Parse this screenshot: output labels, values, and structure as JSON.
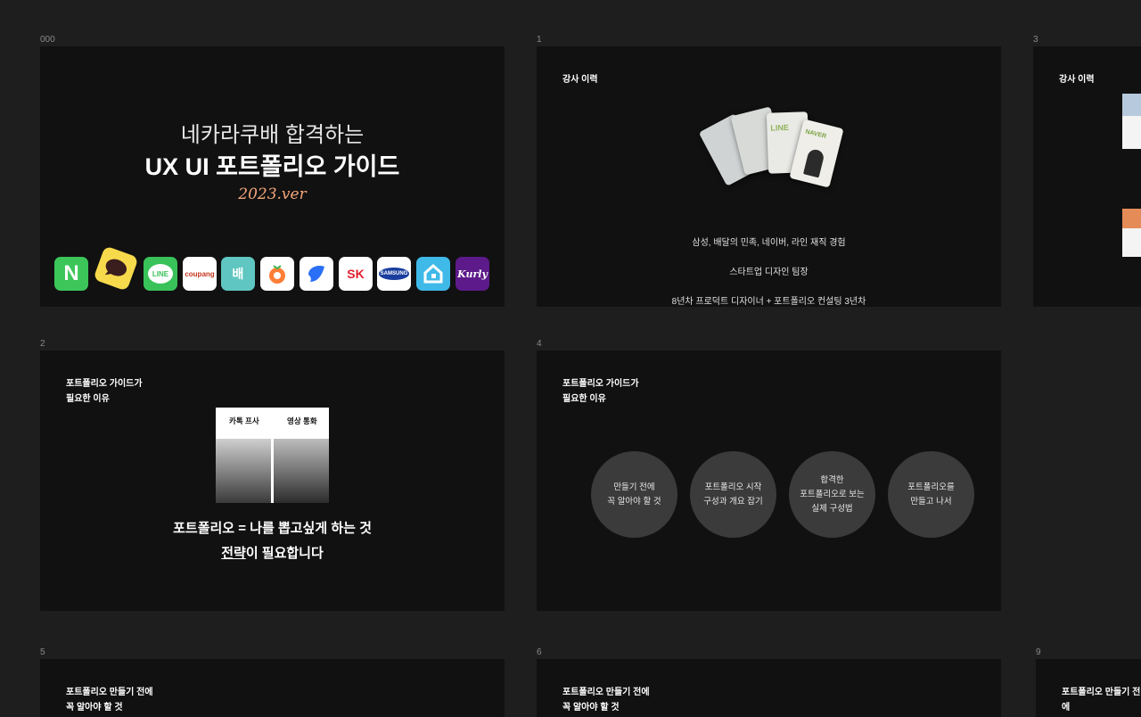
{
  "frames": [
    {
      "label": "000",
      "cover": {
        "line1": "네카라쿠배 합격하는",
        "line2": "UX UI 포트폴리오 가이드",
        "version": "2023.ver",
        "apps": [
          {
            "name": "naver",
            "text": "N",
            "bg": "#3cc65a",
            "fg": "#ffffff"
          },
          {
            "name": "kakaotalk",
            "text": "",
            "bg": "#f7d94c",
            "fg": "#3a1d1d"
          },
          {
            "name": "line",
            "text": "LINE",
            "bg": "#39c25a",
            "fg": "#ffffff"
          },
          {
            "name": "coupang",
            "text": "coupang",
            "bg": "#ffffff",
            "fg": "#c4351c"
          },
          {
            "name": "baemin",
            "text": "배",
            "bg": "#5fc6c1",
            "fg": "#ffffff"
          },
          {
            "name": "daangn",
            "text": "",
            "bg": "#ffffff",
            "fg": "#ff7e36"
          },
          {
            "name": "toss",
            "text": "",
            "bg": "#ffffff",
            "fg": "#2b6ff6"
          },
          {
            "name": "sk",
            "text": "SK",
            "bg": "#ffffff",
            "fg": "#e0202f"
          },
          {
            "name": "samsung",
            "text": "SAMSUNG",
            "bg": "#ffffff",
            "fg": "#1a3e9e"
          },
          {
            "name": "ohouse",
            "text": "",
            "bg": "#3fb9e8",
            "fg": "#ffffff"
          },
          {
            "name": "kurly",
            "text": "Kurly",
            "bg": "#5c1a8a",
            "fg": "#ffffff"
          }
        ]
      }
    },
    {
      "label": "1",
      "title": "강사 이력",
      "cards": {
        "line": "LINE",
        "naver": "NAVER"
      },
      "lines": [
        "삼성, 배달의 민족, 네이버, 라인 재직 경험",
        "스타트업 디자인 팀장",
        "8년차 프로덕트 디자이너 + 포트폴리오 컨설팅 3년차"
      ]
    },
    {
      "label": "3",
      "title": "강사 이력"
    },
    {
      "label": "2",
      "title": "포트폴리오 가이드가\n필요한 이유",
      "compare": {
        "left_header": "카톡 프사",
        "right_header": "영상 통화"
      },
      "statement": "포트폴리오 = 나를 뽑고싶게 하는 것",
      "strategy_word": "전략",
      "strategy_rest": "이 필요합니다"
    },
    {
      "label": "4",
      "title": "포트폴리오 가이드가\n필요한 이유",
      "circles": [
        "만들기 전에\n꼭 알아야 할 것",
        "포트폴리오 시작\n구성과 개요 잡기",
        "합격한\n포트폴리오로 보는\n실제 구성법",
        "포트폴리오를\n만들고 나서"
      ]
    },
    {
      "label": "5",
      "title": "포트폴리오 만들기 전에\n꼭 알아야 할 것"
    },
    {
      "label": "6",
      "title": "포트폴리오 만들기 전에\n꼭 알아야 할 것"
    },
    {
      "label": "9",
      "title": "포트폴리오 만들기 전에\n꼭 알아야 할 것"
    }
  ]
}
